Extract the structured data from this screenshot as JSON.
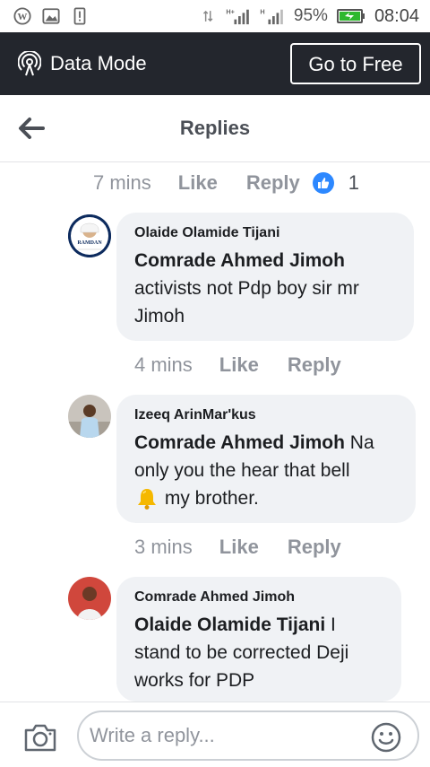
{
  "status_bar": {
    "battery_percent": "95%",
    "time": "08:04",
    "icons": [
      "wordpress-icon",
      "gallery-icon",
      "alert-icon",
      "data-transfer-icon",
      "signal-h-icon",
      "signal-h-icon",
      "battery-charging-icon"
    ]
  },
  "data_bar": {
    "label": "Data Mode",
    "icon": "data-mode-icon",
    "button": "Go to Free"
  },
  "header": {
    "title": "Replies",
    "back_icon": "back-arrow-icon"
  },
  "top_meta": {
    "time": "7 mins",
    "like": "Like",
    "reply": "Reply",
    "like_count": "1"
  },
  "comments": [
    {
      "author": "Olaide Olamide Tijani",
      "mention": "Comrade Ahmed Jimoh",
      "line1_rest": "",
      "line2": "activists not Pdp boy sir mr",
      "line3": "Jimoh",
      "avatar_text": "RAMDAN",
      "meta": {
        "time": "4 mins",
        "like": "Like",
        "reply": "Reply"
      }
    },
    {
      "author": "Izeeq ArinMar'kus",
      "mention": "Comrade Ahmed Jimoh",
      "line1_rest": " Na",
      "line2": "only you the hear that bell",
      "line3": " my brother.",
      "meta": {
        "time": "3 mins",
        "like": "Like",
        "reply": "Reply"
      }
    },
    {
      "author": "Comrade Ahmed Jimoh",
      "mention": "Olaide Olamide Tijani",
      "line1_rest": " I",
      "line2": "stand to be corrected Deji",
      "line3": "works for PDP"
    }
  ],
  "composer": {
    "placeholder": "Write a reply...",
    "camera_icon": "camera-icon",
    "emoji_icon": "emoji-icon"
  },
  "colors": {
    "data_bar_bg": "#23262d",
    "bubble_bg": "#f0f2f5",
    "meta_text": "#90949c",
    "like_blue": "#2d88ff",
    "battery_green": "#2eb82e"
  }
}
